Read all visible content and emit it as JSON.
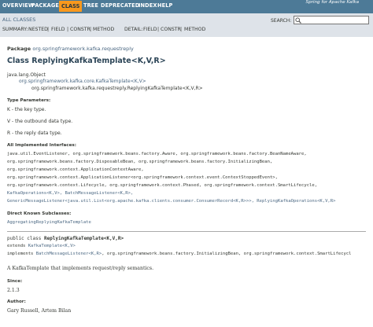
{
  "topnav": {
    "items": [
      "OVERVIEW",
      "PACKAGE",
      "CLASS",
      "TREE",
      "DEPRECATED",
      "INDEX",
      "HELP"
    ],
    "active": "CLASS",
    "about": "Spring for Apache Kafka"
  },
  "subnav": {
    "allclasses": "ALL CLASSES",
    "summary_label": "SUMMARY:",
    "summary_nested": "NESTED",
    "summary_field": "FIELD",
    "summary_constr": "CONSTR",
    "summary_method": "METHOD",
    "detail_label": "DETAIL:",
    "detail_field": "FIELD",
    "detail_constr": "CONSTR",
    "detail_method": "METHOD",
    "search_label": "SEARCH:",
    "search_value": ""
  },
  "header": {
    "package_label": "Package",
    "package_name": "org.springframework.kafka.requestreply",
    "title": "Class ReplyingKafkaTemplate<K,V,R>"
  },
  "inheritance": {
    "l1": "java.lang.Object",
    "l2": "org.springframework.kafka.core.KafkaTemplate<K,V>",
    "l3": "org.springframework.kafka.requestreply.ReplyingKafkaTemplate<K,V,R>"
  },
  "type_params": {
    "label": "Type Parameters:",
    "k": "K - the key type.",
    "v": "V - the outbound data type.",
    "r": "R - the reply data type."
  },
  "interfaces": {
    "label": "All Implemented Interfaces:",
    "line1": "java.util.EventListener, org.springframework.beans.factory.Aware, org.springframework.beans.factory.BeanNameAware,",
    "line2": "org.springframework.beans.factory.DisposableBean, org.springframework.beans.factory.InitializingBean,",
    "line3": "org.springframework.context.ApplicationContextAware,",
    "line4": "org.springframework.context.ApplicationListener<org.springframework.context.event.ContextStoppedEvent>,",
    "line5": "org.springframework.context.Lifecycle, org.springframework.context.Phased, org.springframework.context.SmartLifecycle,",
    "line6a": "KafkaOperations<K,V>,",
    "line6b": "BatchMessageListener<K,R>,",
    "line7a": "GenericMessageListener<java.util.List<org.apache.kafka.clients.consumer.ConsumerRecord<K,R>>>,",
    "line7b": "ReplyingKafkaOperations<K,V,R>"
  },
  "subclasses": {
    "label": "Direct Known Subclasses:",
    "value": "AggregatingReplyingKafkaTemplate"
  },
  "declaration": {
    "line1a": "public class ",
    "line1b": "ReplyingKafkaTemplate<K,V,R>",
    "line2a": "extends ",
    "line2b": "KafkaTemplate<K,V>",
    "line3a": "implements ",
    "line3b": "BatchMessageListener<K,R>",
    "line3c": ", org.springframework.beans.factory.InitializingBean, org.springframework.context.SmartLifecycl"
  },
  "description": "A KafkaTemplate that implements request/reply semantics.",
  "since": {
    "label": "Since:",
    "value": "2.1.3"
  },
  "author": {
    "label": "Author:",
    "value": "Gary Russell, Artem Bilan"
  }
}
